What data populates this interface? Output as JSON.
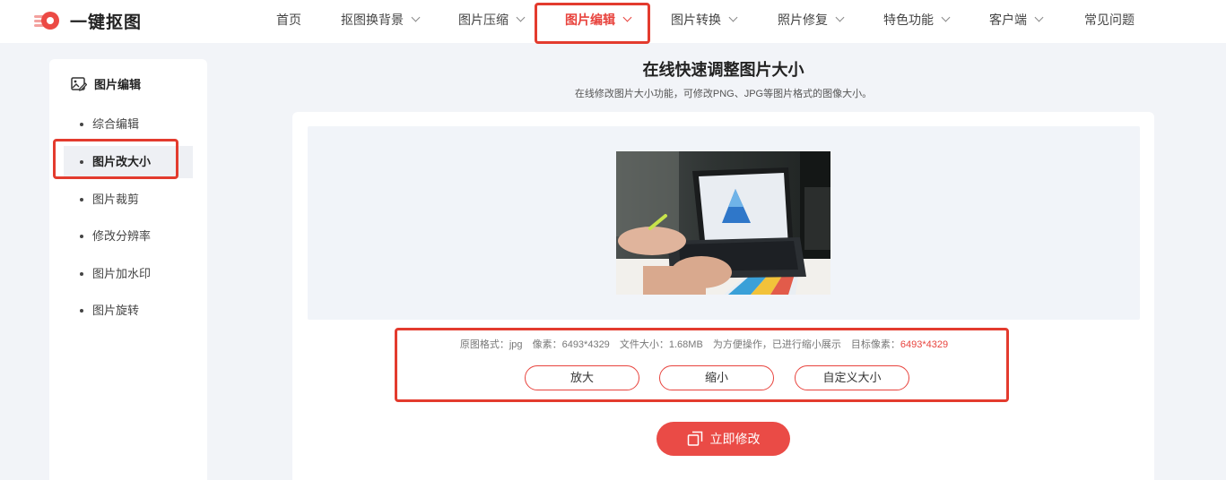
{
  "brand": {
    "name": "一键抠图"
  },
  "nav": {
    "items": [
      {
        "label": "首页",
        "dropdown": false
      },
      {
        "label": "抠图换背景",
        "dropdown": true
      },
      {
        "label": "图片压缩",
        "dropdown": true
      },
      {
        "label": "图片编辑",
        "dropdown": true,
        "active": true
      },
      {
        "label": "图片转换",
        "dropdown": true
      },
      {
        "label": "照片修复",
        "dropdown": true
      },
      {
        "label": "特色功能",
        "dropdown": true
      },
      {
        "label": "客户端",
        "dropdown": true
      },
      {
        "label": "常见问题",
        "dropdown": false
      }
    ]
  },
  "sidebar": {
    "title": "图片编辑",
    "items": [
      {
        "label": "综合编辑"
      },
      {
        "label": "图片改大小",
        "active": true
      },
      {
        "label": "图片裁剪"
      },
      {
        "label": "修改分辨率"
      },
      {
        "label": "图片加水印"
      },
      {
        "label": "图片旋转"
      }
    ]
  },
  "main": {
    "title": "在线快速调整图片大小",
    "subtitle": "在线修改图片大小功能，可修改PNG、JPG等图片格式的图像大小。",
    "info": {
      "format_label": "原图格式：jpg",
      "pixels_label": "像素：6493*4329",
      "size_label": "文件大小：1.68MB",
      "note": "为方便操作，已进行缩小展示",
      "target_label": "目标像素：",
      "target_value": "6493*4329"
    },
    "options": {
      "enlarge": "放大",
      "shrink": "缩小",
      "custom": "自定义大小"
    },
    "submit": "立即修改"
  },
  "colors": {
    "accent": "#e8433d",
    "highlight_border": "#e33b2e"
  },
  "icons": {
    "logo": "logo-icon",
    "sidebar_title": "image-edit-icon",
    "submit": "resize-icon"
  }
}
